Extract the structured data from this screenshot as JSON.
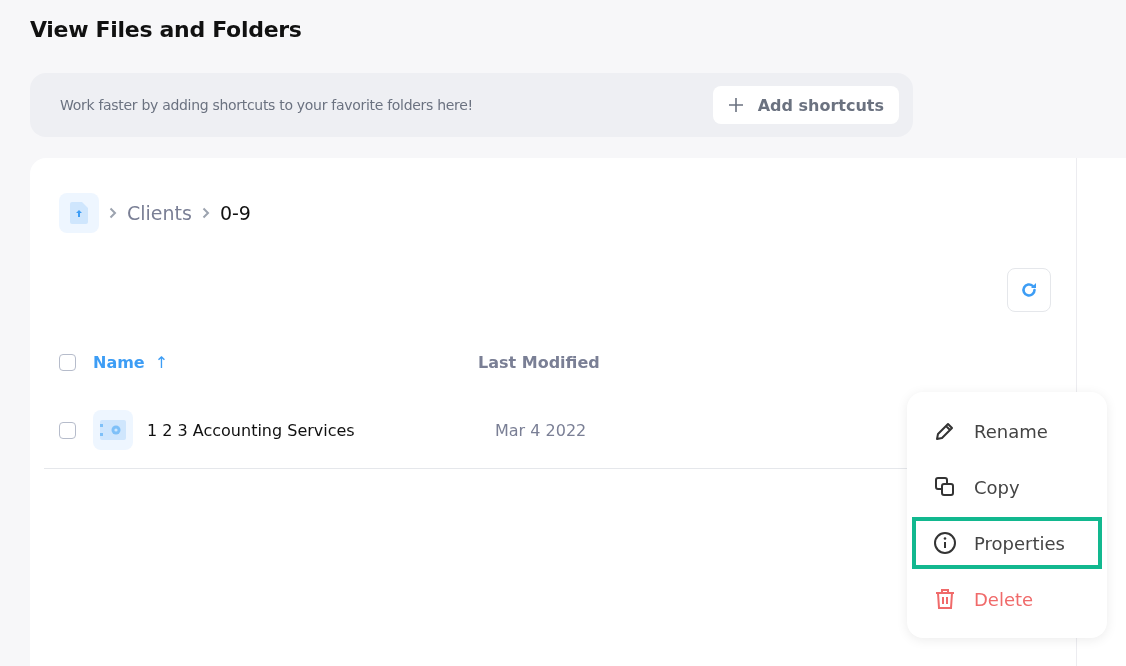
{
  "page": {
    "title": "View Files and Folders"
  },
  "shortcuts_bar": {
    "message": "Work faster by adding shortcuts to your favorite folders here!",
    "button": "Add shortcuts"
  },
  "breadcrumb": [
    {
      "label": "Clients",
      "current": false
    },
    {
      "label": "0-9",
      "current": true
    }
  ],
  "table": {
    "select_all_checked": false,
    "columns": [
      {
        "label": "Name",
        "sorted": true,
        "sort_icon": "↑"
      },
      {
        "label": "Last Modified",
        "sorted": false
      }
    ],
    "rows": [
      {
        "name": "1 2 3 Accounting Services",
        "modified": "Mar 4 2022",
        "checked": false
      }
    ]
  },
  "context_menu": {
    "items": [
      {
        "label": "Rename",
        "kind": "rename",
        "selected": false
      },
      {
        "label": "Copy",
        "kind": "copy",
        "selected": false
      },
      {
        "label": "Properties",
        "kind": "info",
        "selected": true
      },
      {
        "label": "Delete",
        "kind": "delete",
        "selected": false
      }
    ]
  }
}
